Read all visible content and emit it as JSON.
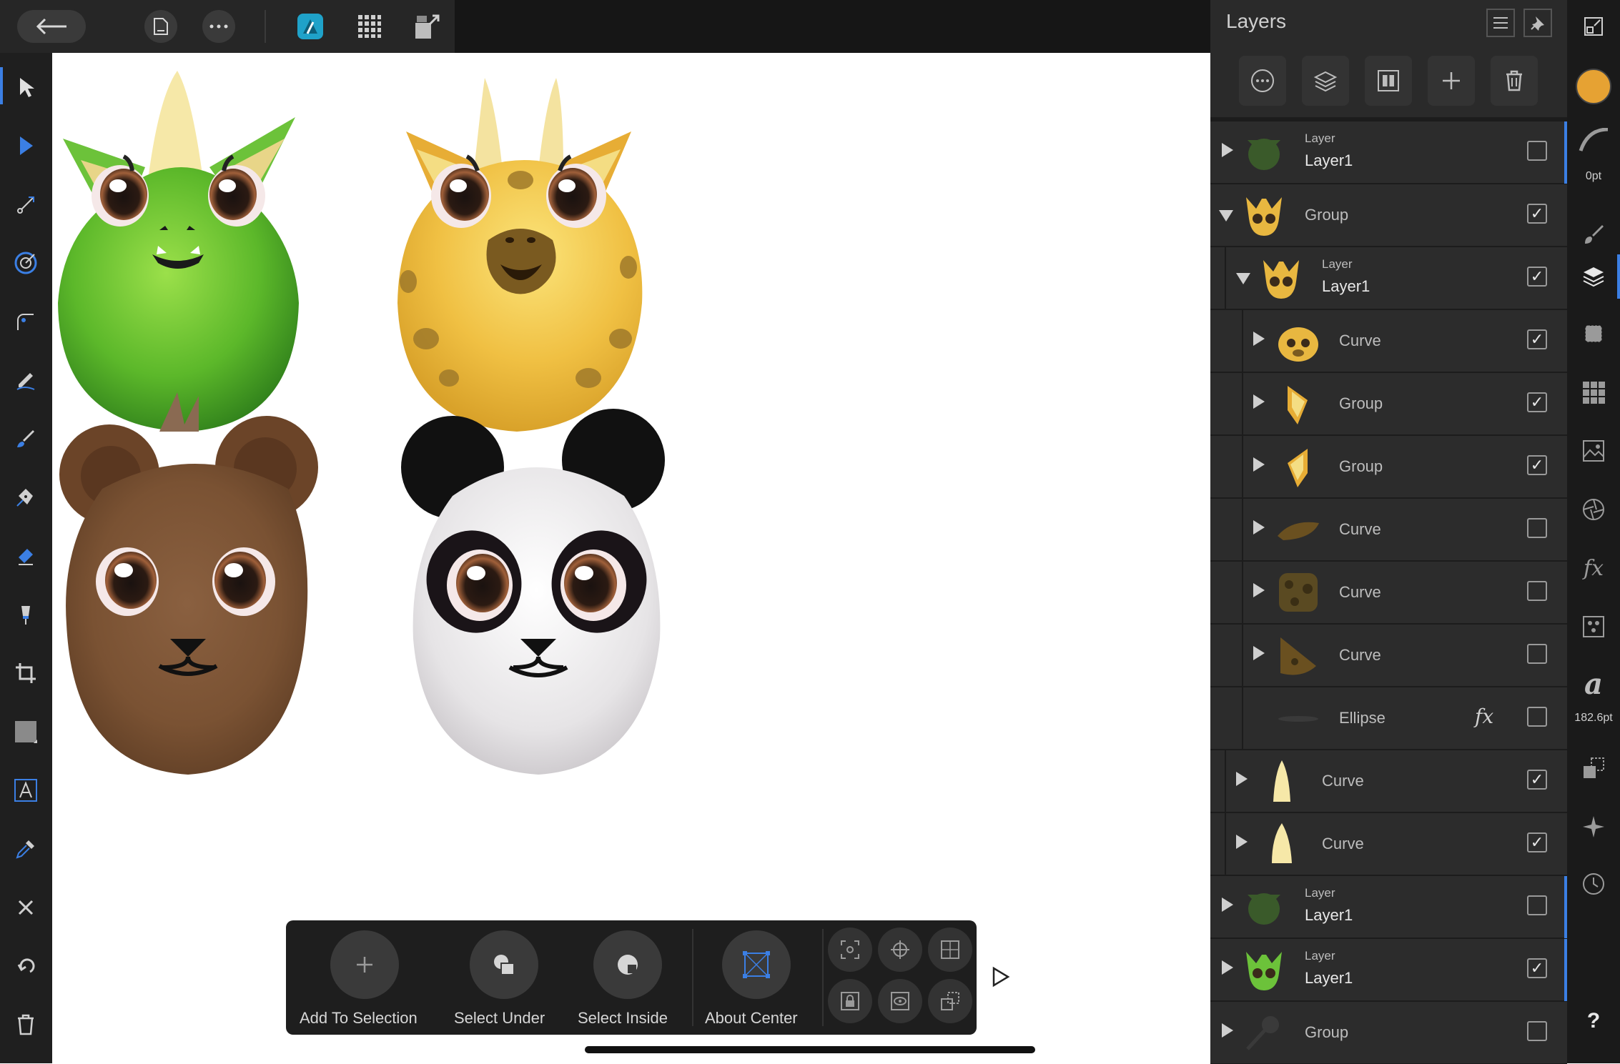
{
  "top_bar": {
    "back_icon": "arrow-left-icon",
    "document_icon": "document-icon",
    "more_icon": "more-icon",
    "persona_icon": "designer-persona-icon",
    "pixel_persona_icon": "pixel-persona-icon",
    "export_persona_icon": "export-persona-icon"
  },
  "layers_panel": {
    "title": "Layers",
    "rows": [
      {
        "kind": "Layer",
        "name": "Layer1",
        "checked": false,
        "accent": true
      },
      {
        "kind": "",
        "name": "Group",
        "checked": true,
        "accent": false
      },
      {
        "kind": "Layer",
        "name": "Layer1",
        "checked": true,
        "accent": false
      },
      {
        "kind": "",
        "name": "Curve",
        "checked": true,
        "accent": false
      },
      {
        "kind": "",
        "name": "Group",
        "checked": true,
        "accent": false
      },
      {
        "kind": "",
        "name": "Group",
        "checked": true,
        "accent": false
      },
      {
        "kind": "",
        "name": "Curve",
        "checked": false,
        "accent": false
      },
      {
        "kind": "",
        "name": "Curve",
        "checked": false,
        "accent": false
      },
      {
        "kind": "",
        "name": "Curve",
        "checked": false,
        "accent": false
      },
      {
        "kind": "",
        "name": "Ellipse",
        "checked": false,
        "accent": false,
        "fx": "fx"
      },
      {
        "kind": "",
        "name": "Curve",
        "checked": true,
        "accent": false
      },
      {
        "kind": "",
        "name": "Curve",
        "checked": true,
        "accent": false
      },
      {
        "kind": "Layer",
        "name": "Layer1",
        "checked": false,
        "accent": true
      },
      {
        "kind": "Layer",
        "name": "Layer1",
        "checked": true,
        "accent": true
      },
      {
        "kind": "",
        "name": "Group",
        "checked": false,
        "accent": false
      }
    ]
  },
  "studio": {
    "stroke_width": "0pt",
    "font_size": "182.6pt",
    "help": "?",
    "fill_color": "#e6a233"
  },
  "context_toolbar": {
    "add_to_selection": "Add To Selection",
    "select_under": "Select Under",
    "select_inside": "Select Inside",
    "about_center": "About Center"
  },
  "colors": {
    "accent": "#3b7fe4",
    "panel": "#2c2c2c"
  }
}
